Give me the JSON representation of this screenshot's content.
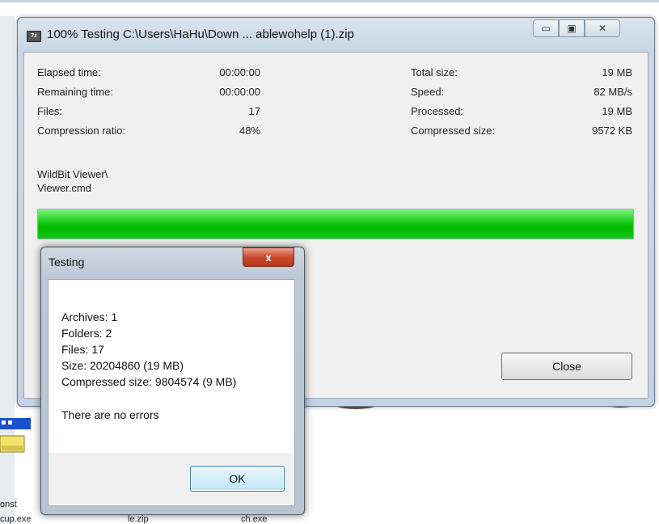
{
  "main_window": {
    "title": "100% Testing C:\\Users\\HaHu\\Down ... ablewohelp (1).zip",
    "icon_label": "7z",
    "caption_buttons": [
      {
        "name": "minimize-icon",
        "glyph": "▭"
      },
      {
        "name": "maximize-icon",
        "glyph": "▣"
      },
      {
        "name": "close-icon",
        "glyph": "✕"
      }
    ],
    "stats_left": [
      {
        "label": "Elapsed time:",
        "value": "00:00:00"
      },
      {
        "label": "Remaining time:",
        "value": "00:00:00"
      },
      {
        "label": "Files:",
        "value": "17"
      },
      {
        "label": "Compression ratio:",
        "value": "48%"
      }
    ],
    "stats_right": [
      {
        "label": "Total size:",
        "value": "19 MB"
      },
      {
        "label": "Speed:",
        "value": "82 MB/s"
      },
      {
        "label": "Processed:",
        "value": "19 MB"
      },
      {
        "label": "Compressed size:",
        "value": "9572 KB"
      }
    ],
    "current_path": [
      "WildBit Viewer\\",
      "Viewer.cmd"
    ],
    "progress_fraction": 1.0,
    "close_label": "Close"
  },
  "testing_dialog": {
    "title": "Testing",
    "close_glyph": "x",
    "summary_lines": [
      "Archives: 1",
      "Folders: 2",
      "Files: 17",
      "Size: 20204860 (19 MB)",
      "Compressed size: 9804574 (9 MB)"
    ],
    "message": "There are no errors",
    "ok_label": "OK"
  },
  "desktop": {
    "labels": [
      "onst",
      "cup.exe",
      "le.zip",
      "ch.exe"
    ]
  },
  "colors": {
    "progress": "#20d020",
    "dialog_close": "#c94a2e"
  }
}
